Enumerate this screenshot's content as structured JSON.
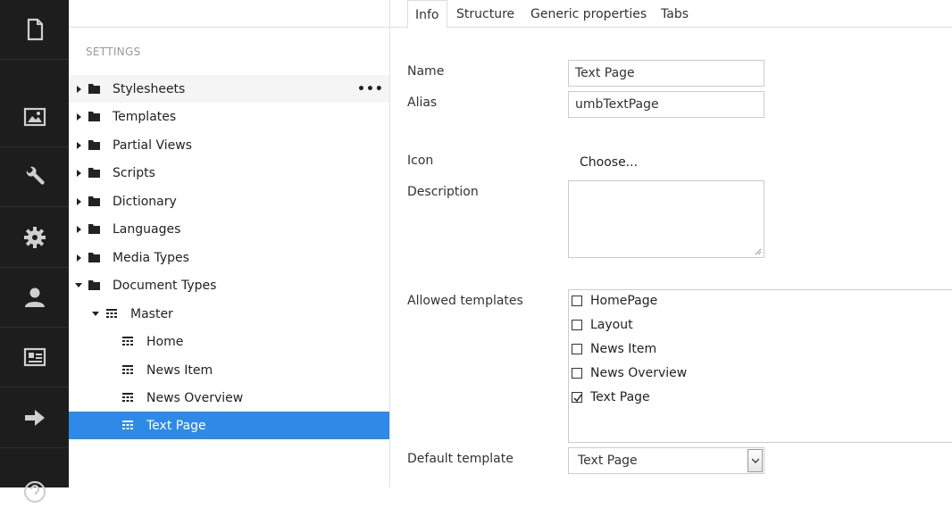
{
  "rail": {
    "items": [
      {
        "icon": "document-icon"
      },
      {
        "icon": "image-icon"
      },
      {
        "icon": "wrench-icon"
      },
      {
        "icon": "gear-icon"
      },
      {
        "icon": "user-icon"
      },
      {
        "icon": "id-card-icon"
      },
      {
        "icon": "arrow-right-icon"
      },
      {
        "icon": "help-icon"
      }
    ]
  },
  "tree": {
    "section_title": "SETTINGS",
    "more_actions": "•••",
    "items": [
      {
        "label": "Stylesheets"
      },
      {
        "label": "Templates"
      },
      {
        "label": "Partial Views"
      },
      {
        "label": "Scripts"
      },
      {
        "label": "Dictionary"
      },
      {
        "label": "Languages"
      },
      {
        "label": "Media Types"
      },
      {
        "label": "Document Types"
      },
      {
        "label": "Master"
      },
      {
        "label": "Home"
      },
      {
        "label": "News Item"
      },
      {
        "label": "News Overview"
      },
      {
        "label": "Text Page"
      }
    ],
    "selected_color": "#2e8ae6"
  },
  "tabs": [
    {
      "label": "Info"
    },
    {
      "label": "Structure"
    },
    {
      "label": "Generic properties"
    },
    {
      "label": "Tabs"
    }
  ],
  "form": {
    "name_label": "Name",
    "name_value": "Text Page",
    "alias_label": "Alias",
    "alias_value": "umbTextPage",
    "icon_label": "Icon",
    "icon_choose": "Choose...",
    "description_label": "Description",
    "allowed_templates_label": "Allowed templates",
    "templates": [
      {
        "label": "HomePage",
        "checked": false
      },
      {
        "label": "Layout",
        "checked": false
      },
      {
        "label": "News Item",
        "checked": false
      },
      {
        "label": "News Overview",
        "checked": false
      },
      {
        "label": "Text Page",
        "checked": true
      }
    ],
    "default_template_label": "Default template",
    "default_template_value": "Text Page"
  }
}
